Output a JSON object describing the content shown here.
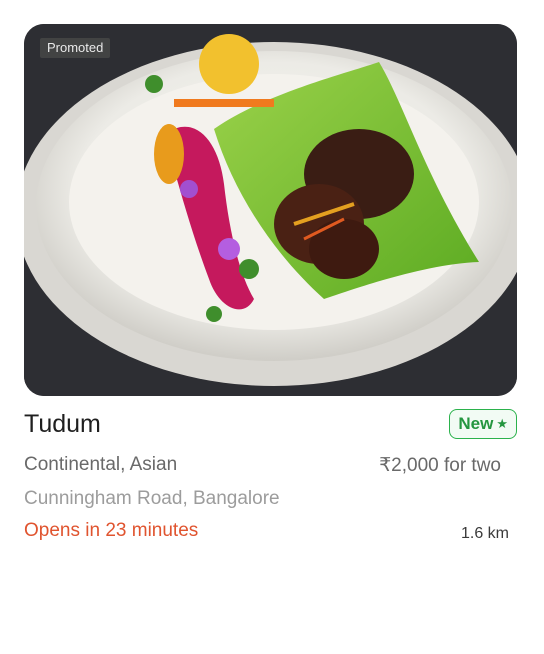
{
  "card": {
    "promoted_label": "Promoted",
    "restaurant_name": "Tudum",
    "badge": {
      "label": "New",
      "icon": "star-icon",
      "color": "#24963f"
    },
    "cuisines": "Continental, Asian",
    "price": "₹2,000 for two",
    "locality": "Cunningham Road, Bangalore",
    "status": "Opens in 23 minutes",
    "distance": "1.6 km",
    "colors": {
      "status": "#e0542f",
      "badge_border": "#2bb24c"
    }
  }
}
